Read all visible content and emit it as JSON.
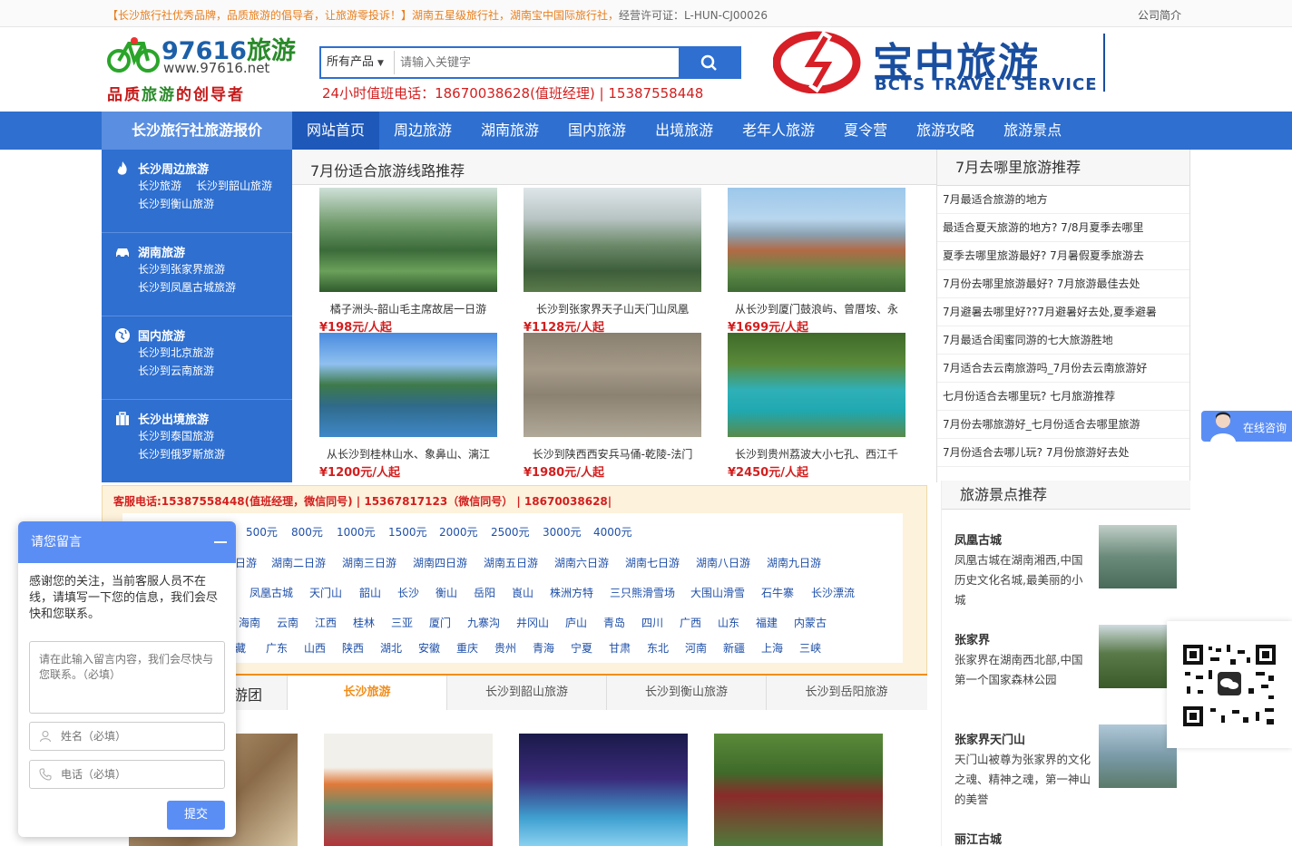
{
  "topbar": {
    "msg_orange1": "【长沙旅行社优秀品牌，品质旅游的倡导者，让旅游零投诉！】",
    "msg_orange2": "湖南五星级旅行社，湖南宝中国际旅行社，",
    "msg_gray": "经营许可证：L-HUN-CJ00026",
    "about": "公司简介"
  },
  "logo": {
    "title_num": "97616",
    "title_cn": "旅游",
    "url": "www.97616.net",
    "slogan_a": "品质",
    "slogan_b": "旅游",
    "slogan_c": "的创导者"
  },
  "search": {
    "category": "所有产品",
    "placeholder": "请输入关键字"
  },
  "hotline": "24小时值班电话：18670038628(值班经理) | 15387558448",
  "brand": {
    "cn": "宝中旅游",
    "en": "BCTS TRAVEL SERVICE"
  },
  "nav": {
    "side_title": "长沙旅行社旅游报价",
    "items": [
      "网站首页",
      "周边旅游",
      "湖南旅游",
      "国内旅游",
      "出境旅游",
      "老年人旅游",
      "夏令营",
      "旅游攻略",
      "旅游景点"
    ]
  },
  "sidemenu": [
    {
      "title": "长沙周边旅游",
      "links": [
        "长沙旅游",
        "长沙到韶山旅游",
        "长沙到衡山旅游"
      ]
    },
    {
      "title": "湖南旅游",
      "links": [
        "长沙到张家界旅游",
        "长沙到凤凰古城旅游"
      ]
    },
    {
      "title": "国内旅游",
      "links": [
        "长沙到北京旅游",
        "长沙到云南旅游"
      ]
    },
    {
      "title": "长沙出境旅游",
      "links": [
        "长沙到泰国旅游",
        "长沙到俄罗斯旅游"
      ]
    }
  ],
  "featured": {
    "title": "7月份适合旅游线路推荐",
    "cards": [
      {
        "caption": "橘子洲头-韶山毛主席故居一日游",
        "price": "¥198元/人起"
      },
      {
        "caption": "长沙到张家界天子山天门山凤凰",
        "price": "¥1128元/人起"
      },
      {
        "caption": "从长沙到厦门鼓浪屿、曾厝垵、永",
        "price": "¥1699元/人起"
      },
      {
        "caption": "从长沙到桂林山水、象鼻山、漓江",
        "price": "¥1200元/人起"
      },
      {
        "caption": "长沙到陕西西安兵马俑-乾陵-法门",
        "price": "¥1980元/人起"
      },
      {
        "caption": "长沙到贵州荔波大小七孔、西江千",
        "price": "¥2450元/人起"
      }
    ]
  },
  "rlist": {
    "title": "7月去哪里旅游推荐",
    "items": [
      "7月最适合旅游的地方",
      "最适合夏天旅游的地方? 7/8月夏季去哪里",
      "夏季去哪里旅游最好? 7月暑假夏季旅游去",
      "7月份去哪里旅游最好? 7月旅游最佳去处",
      "7月避暑去哪里好??7月避暑好去处,夏季避暑",
      "7月最适合闺蜜同游的七大旅游胜地",
      "7月适合去云南旅游吗_7月份去云南旅游好",
      "七月份适合去哪里玩? 七月旅游推荐",
      "7月份去哪旅游好_七月份适合去哪里旅游",
      "7月份适合去哪儿玩? 7月份旅游好去处"
    ]
  },
  "filter": {
    "service": "客服电话:15387558448(值班经理，微信同号) | 15367817123（微信同号） | 18670038628|",
    "prices": [
      "500元",
      "800元",
      "1000元",
      "1500元",
      "2000元",
      "2500元",
      "3000元",
      "4000元"
    ],
    "days": [
      "日游",
      "湖南二日游",
      "湖南三日游",
      "湖南四日游",
      "湖南五日游",
      "湖南六日游",
      "湖南七日游",
      "湖南八日游",
      "湖南九日游"
    ],
    "spots": [
      "凤凰古城",
      "天门山",
      "韶山",
      "长沙",
      "衡山",
      "岳阳",
      "崀山",
      "株洲方特",
      "三只熊滑雪场",
      "大围山滑雪",
      "石牛寨",
      "长沙漂流"
    ],
    "provinces1": [
      "海南",
      "云南",
      "江西",
      "桂林",
      "三亚",
      "厦门",
      "九寨沟",
      "井冈山",
      "庐山",
      "青岛",
      "四川",
      "广西",
      "山东",
      "福建",
      "内蒙古"
    ],
    "provinces2": [
      "藏",
      "广东",
      "山西",
      "陕西",
      "湖北",
      "安徽",
      "重庆",
      "贵州",
      "青海",
      "宁夏",
      "甘肃",
      "东北",
      "河南",
      "新疆",
      "上海",
      "三峡"
    ]
  },
  "tabs": {
    "label": "游团",
    "items": [
      "长沙旅游",
      "长沙到韶山旅游",
      "长沙到衡山旅游",
      "长沙到岳阳旅游"
    ]
  },
  "spots": {
    "title": "旅游景点推荐",
    "items": [
      {
        "name": "凤凰古城",
        "desc": "凤凰古城在湖南湘西,中国历史文化名城,最美丽的小城"
      },
      {
        "name": "张家界",
        "desc": "张家界在湖南西北部,中国第一个国家森林公园"
      },
      {
        "name": "张家界天门山",
        "desc": "天门山被尊为张家界的文化之魂、精神之魂，第一神山的美誉"
      },
      {
        "name": "丽江古城",
        "desc": ""
      }
    ]
  },
  "chat": {
    "title": "请您留言",
    "notice": "感谢您的关注，当前客服人员不在线，请填写一下您的信息，我们会尽快和您联系。",
    "msg_placeholder": "请在此输入留言内容，我们会尽快与您联系。（必填）",
    "name_placeholder": "姓名（必填）",
    "phone_placeholder": "电话（必填）",
    "submit": "提交"
  },
  "consult": "在线咨询",
  "colors": {
    "primary": "#2e6fd0",
    "accent": "#f18d1a",
    "price": "#d21f1f"
  }
}
